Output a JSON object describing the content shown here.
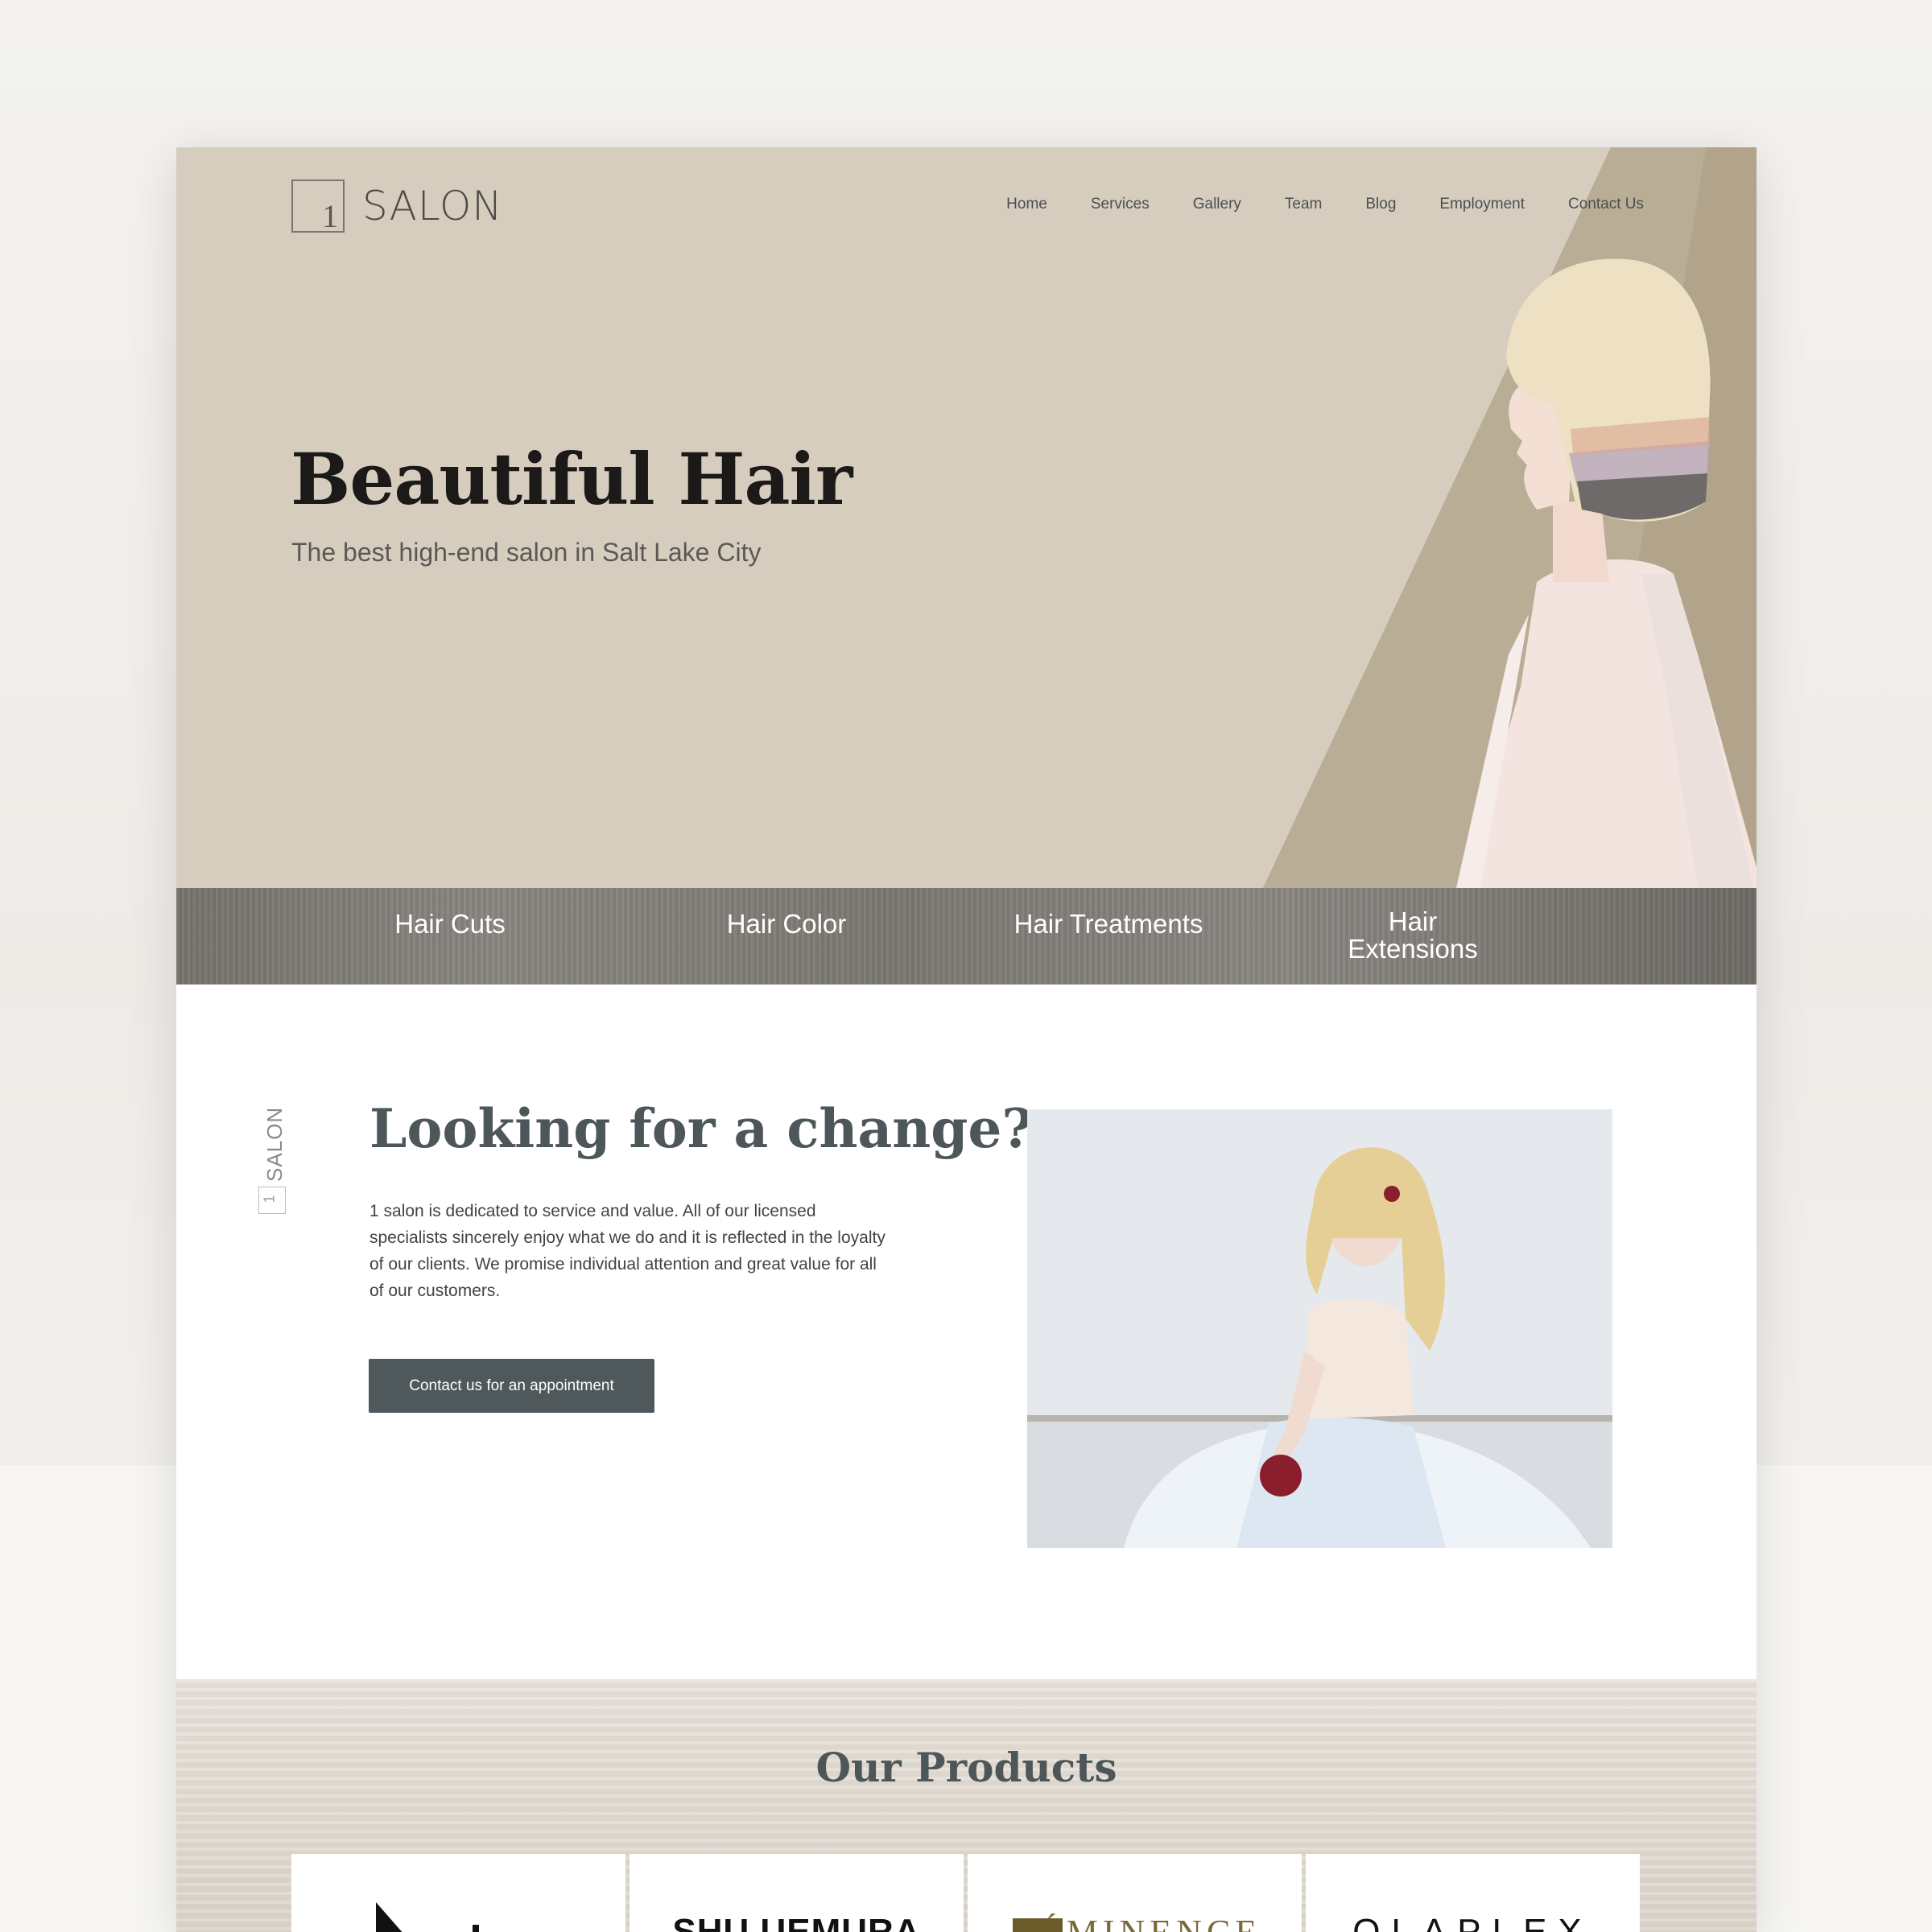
{
  "brand": {
    "logo_mark": "1",
    "name": "SALON"
  },
  "nav": [
    "Home",
    "Services",
    "Gallery",
    "Team",
    "Blog",
    "Employment",
    "Contact Us"
  ],
  "hero": {
    "title": "Beautiful Hair",
    "subtitle": "The best high-end salon in Salt Lake City"
  },
  "services": [
    "Hair Cuts",
    "Hair Color",
    "Hair Treatments",
    "Hair Extensions"
  ],
  "about": {
    "side_logo": "SALON",
    "side_mark": "1",
    "title": "Looking for a change?",
    "text": "1 salon is dedicated to service and value. All of our licensed specialists sincerely enjoy what we do and it is reflected in the loyalty of our clients. We promise individual attention and great value for all of our customers.",
    "cta": "Contact us for an appointment"
  },
  "products": {
    "title": "Our Products",
    "brands": [
      "",
      "SHU UEMURA",
      "ÉMINENCE",
      "OLAPLEX"
    ]
  },
  "colors": {
    "hero_bg": "#d6cdbf",
    "hero_diag": "#b7ab93",
    "cta_bg": "#4f585b",
    "heading": "#4d5658"
  }
}
